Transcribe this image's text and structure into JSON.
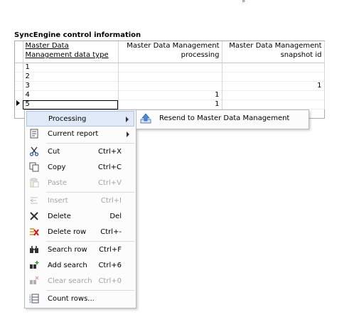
{
  "corner_mark": "°",
  "section_title": "SyncEngine control information",
  "grid": {
    "columns": [
      "Master Data Management data type",
      "Master Data Management processing",
      "Master Data Management snapshot id"
    ],
    "rows": [
      [
        "1",
        "",
        ""
      ],
      [
        "2",
        "",
        ""
      ],
      [
        "3",
        "",
        "1"
      ],
      [
        "4",
        "1",
        ""
      ],
      [
        "5",
        "1",
        ""
      ]
    ],
    "current_row": 5
  },
  "context_menu": {
    "items": [
      {
        "label": "Processing",
        "shortcut": "",
        "icon": "none",
        "submenu": true,
        "enabled": true
      },
      {
        "label": "Current report",
        "shortcut": "",
        "icon": "report-icon",
        "submenu": true,
        "enabled": true
      },
      {
        "label": "Cut",
        "shortcut": "Ctrl+X",
        "icon": "scissors-icon",
        "enabled": true
      },
      {
        "label": "Copy",
        "shortcut": "Ctrl+C",
        "icon": "copy-icon",
        "enabled": true
      },
      {
        "label": "Paste",
        "shortcut": "Ctrl+V",
        "icon": "paste-icon",
        "enabled": false
      },
      {
        "label": "Insert",
        "shortcut": "Ctrl+I",
        "icon": "insert-icon",
        "enabled": false
      },
      {
        "label": "Delete",
        "shortcut": "Del",
        "icon": "delete-icon",
        "enabled": true
      },
      {
        "label": "Delete row",
        "shortcut": "Ctrl+-",
        "icon": "delete-row-icon",
        "enabled": true
      },
      {
        "label": "Search row",
        "shortcut": "Ctrl+F",
        "icon": "binoculars-icon",
        "enabled": true
      },
      {
        "label": "Add search",
        "shortcut": "Ctrl+6",
        "icon": "add-search-icon",
        "enabled": true
      },
      {
        "label": "Clear search",
        "shortcut": "Ctrl+0",
        "icon": "clear-search-icon",
        "enabled": false
      },
      {
        "label": "Count rows...",
        "shortcut": "",
        "icon": "count-rows-icon",
        "enabled": true
      }
    ]
  },
  "submenu": {
    "items": [
      {
        "label": "Resend to Master Data Management",
        "icon": "resend-icon"
      }
    ]
  }
}
